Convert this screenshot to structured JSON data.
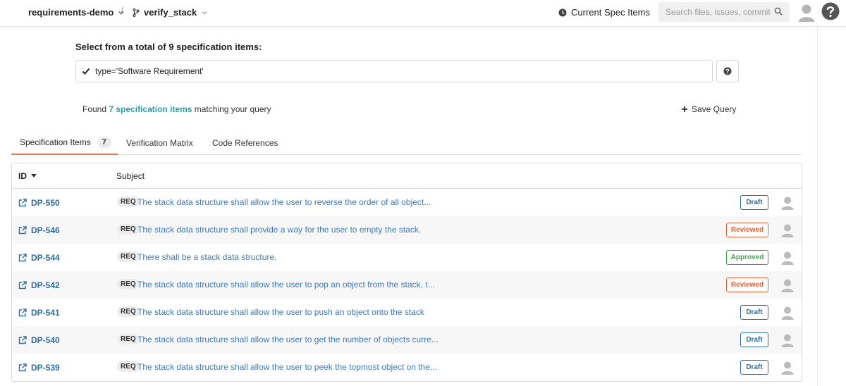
{
  "topbar": {
    "repo": "requirements-demo",
    "separator": "/",
    "branch": "verify_stack",
    "spec_link": "Current Spec Items",
    "search_placeholder": "Search files, issues, commits"
  },
  "query": {
    "title": "Select from a total of 9 specification items:",
    "value": "type='Software Requirement'",
    "found_prefix": "Found",
    "found_highlight": "7 specification items",
    "found_suffix": "matching your query",
    "save_label": "Save Query"
  },
  "tabs": [
    {
      "label": "Specification Items",
      "count": "7"
    },
    {
      "label": "Verification Matrix"
    },
    {
      "label": "Code References"
    }
  ],
  "table": {
    "col_id": "ID",
    "col_subject": "Subject",
    "rows": [
      {
        "id": "DP-550",
        "tag": "REQ",
        "subject": "The stack data structure shall allow the user to reverse the order of all object...",
        "status": "Draft"
      },
      {
        "id": "DP-546",
        "tag": "REQ",
        "subject": "The stack data structure shall provide a way for the user to empty the stack.",
        "status": "Reviewed"
      },
      {
        "id": "DP-544",
        "tag": "REQ",
        "subject": "There shall be a stack data structure.",
        "status": "Approved"
      },
      {
        "id": "DP-542",
        "tag": "REQ",
        "subject": "The stack data structure shall allow the user to pop an object from the stack, t...",
        "status": "Reviewed"
      },
      {
        "id": "DP-541",
        "tag": "REQ",
        "subject": "The stack data structure shall allow the user to push an object onto the stack",
        "status": "Draft"
      },
      {
        "id": "DP-540",
        "tag": "REQ",
        "subject": "The stack data structure shall allow the user to get the number of objects curre...",
        "status": "Draft"
      },
      {
        "id": "DP-539",
        "tag": "REQ",
        "subject": "The stack data structure shall allow the user to peek the topmost object on the...",
        "status": "Draft"
      }
    ]
  },
  "colors": {
    "accent_teal": "#2a9fa3",
    "link_blue": "#2e6da4",
    "tab_active": "#e07a4f",
    "status_draft": "#2e6da4",
    "status_reviewed": "#e0643a",
    "status_approved": "#3aa84a"
  },
  "icons": {
    "repo_dropdown": "chevron-down-icon",
    "branch": "git-branch-icon",
    "spec_items": "clock-icon",
    "search": "search-icon",
    "user": "avatar-icon",
    "help": "help-circle-icon",
    "query_valid": "check-icon",
    "save": "plus-icon",
    "sort": "caret-down-icon",
    "row_link": "external-link-icon"
  }
}
